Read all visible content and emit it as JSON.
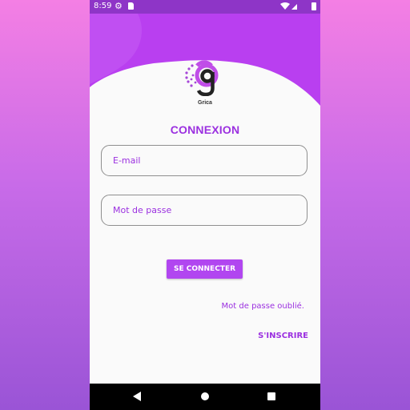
{
  "status_bar": {
    "time": "8:59",
    "icons": [
      "gear-icon",
      "sd-card-icon",
      "wifi-icon",
      "signal-icon",
      "battery-icon"
    ]
  },
  "header": {
    "brand_name": "Grica",
    "colors": {
      "primary": "#9b30e0",
      "header": "#b93ff0",
      "status": "#8e35c7"
    }
  },
  "login": {
    "title": "CONNEXION",
    "email_placeholder": "E-mail",
    "password_placeholder": "Mot de passe",
    "submit_label": "SE CONNECTER",
    "forgot_label": "Mot de passe oublié.",
    "signup_label": "S'INSCRIRE"
  },
  "nav_bar": {
    "icons": [
      "back-icon",
      "home-icon",
      "recent-apps-icon"
    ]
  }
}
